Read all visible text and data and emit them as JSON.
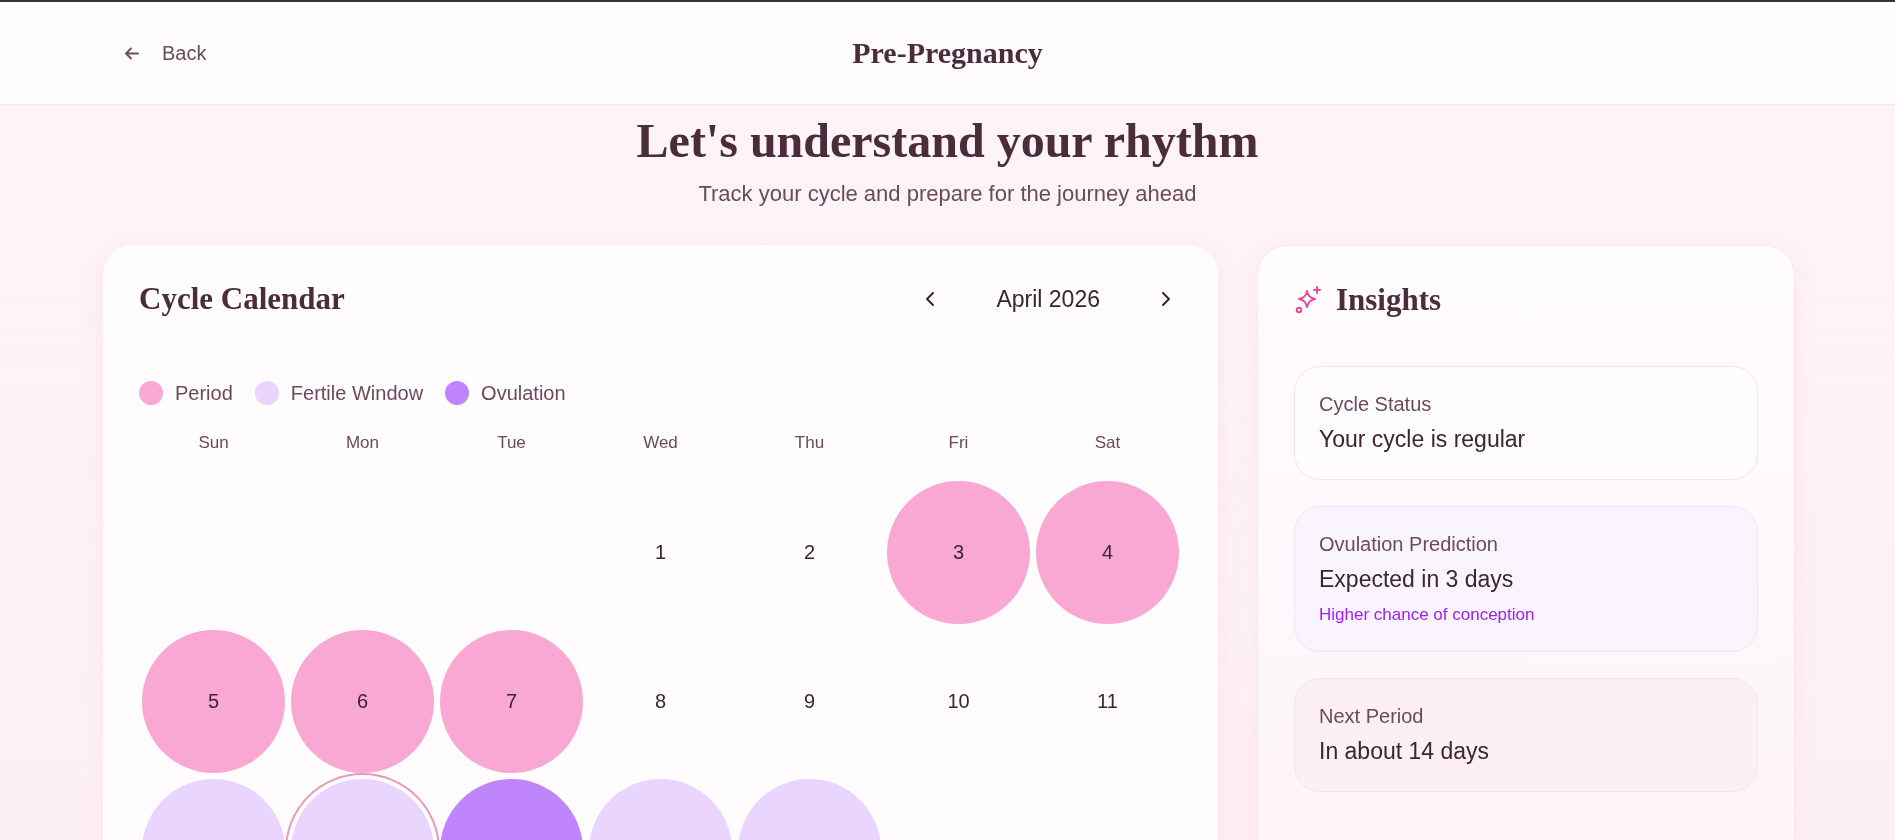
{
  "header": {
    "back_label": "Back",
    "title": "Pre-Pregnancy"
  },
  "hero": {
    "title": "Let's understand your rhythm",
    "subtitle": "Track your cycle and prepare for the journey ahead"
  },
  "calendar": {
    "title": "Cycle Calendar",
    "month": "April 2026",
    "legend": [
      {
        "label": "Period",
        "color": "#f9a8d4"
      },
      {
        "label": "Fertile Window",
        "color": "#e9d5ff"
      },
      {
        "label": "Ovulation",
        "color": "#c084fc"
      }
    ],
    "weekdays": [
      "Sun",
      "Mon",
      "Tue",
      "Wed",
      "Thu",
      "Fri",
      "Sat"
    ],
    "days": [
      {
        "kind": "blank"
      },
      {
        "kind": "blank"
      },
      {
        "kind": "blank"
      },
      {
        "label": "1",
        "kind": "normal",
        "today": false
      },
      {
        "label": "2",
        "kind": "normal",
        "today": false
      },
      {
        "label": "3",
        "kind": "period",
        "today": false
      },
      {
        "label": "4",
        "kind": "period",
        "today": false
      },
      {
        "label": "5",
        "kind": "period",
        "today": false
      },
      {
        "label": "6",
        "kind": "period",
        "today": false
      },
      {
        "label": "7",
        "kind": "period",
        "today": false
      },
      {
        "label": "8",
        "kind": "normal",
        "today": false
      },
      {
        "label": "9",
        "kind": "normal",
        "today": false
      },
      {
        "label": "10",
        "kind": "normal",
        "today": false
      },
      {
        "label": "11",
        "kind": "normal",
        "today": false
      },
      {
        "kind": "fertile",
        "today": false
      },
      {
        "kind": "fertile",
        "today": true
      },
      {
        "kind": "ovulation",
        "today": false
      },
      {
        "kind": "fertile",
        "today": false
      },
      {
        "kind": "fertile",
        "today": false
      }
    ]
  },
  "insights": {
    "title": "Insights",
    "cards": [
      {
        "kind": "neutral",
        "label": "Cycle Status",
        "value": "Your cycle is regular"
      },
      {
        "kind": "fertile",
        "label": "Ovulation Prediction",
        "value": "Expected in 3 days",
        "note": "Higher chance of conception"
      },
      {
        "kind": "period",
        "label": "Next Period",
        "value": "In about 14 days"
      }
    ]
  }
}
